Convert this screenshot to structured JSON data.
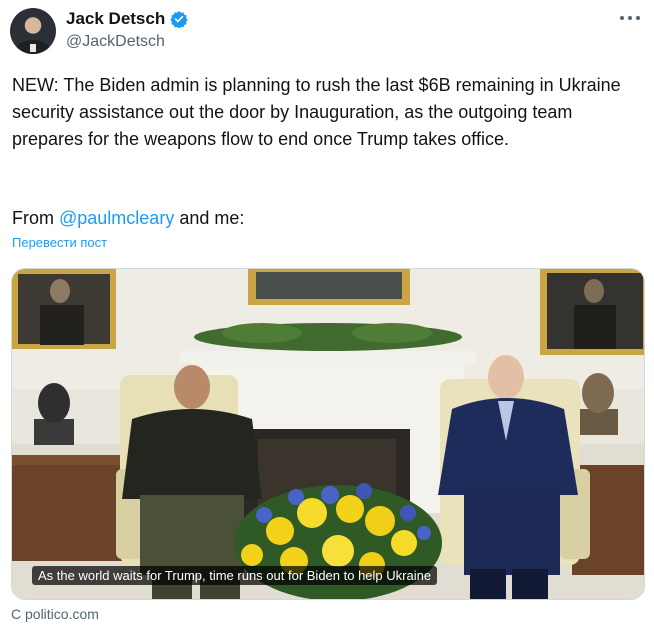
{
  "author": {
    "display_name": "Jack Detsch",
    "handle": "@JackDetsch",
    "verified": true
  },
  "tweet": {
    "text": "NEW: The Biden admin is planning to rush the last $6B remaining in Ukraine security assistance out the door by Inauguration, as the outgoing team prepares for the weapons flow to end once Trump takes office.",
    "from_prefix": "From ",
    "mention": "@paulmcleary",
    "from_suffix": " and me:",
    "translate_label": "Перевести пост"
  },
  "card": {
    "headline": "As the world waits for Trump, time runs out for Biden to help Ukraine",
    "source": "C politico.com"
  },
  "icons": {
    "more": "more-dots-icon",
    "verified": "verified-badge-icon"
  },
  "colors": {
    "link": "#1d9bf0",
    "secondary_text": "#536471",
    "verified": "#1d9bf0"
  }
}
